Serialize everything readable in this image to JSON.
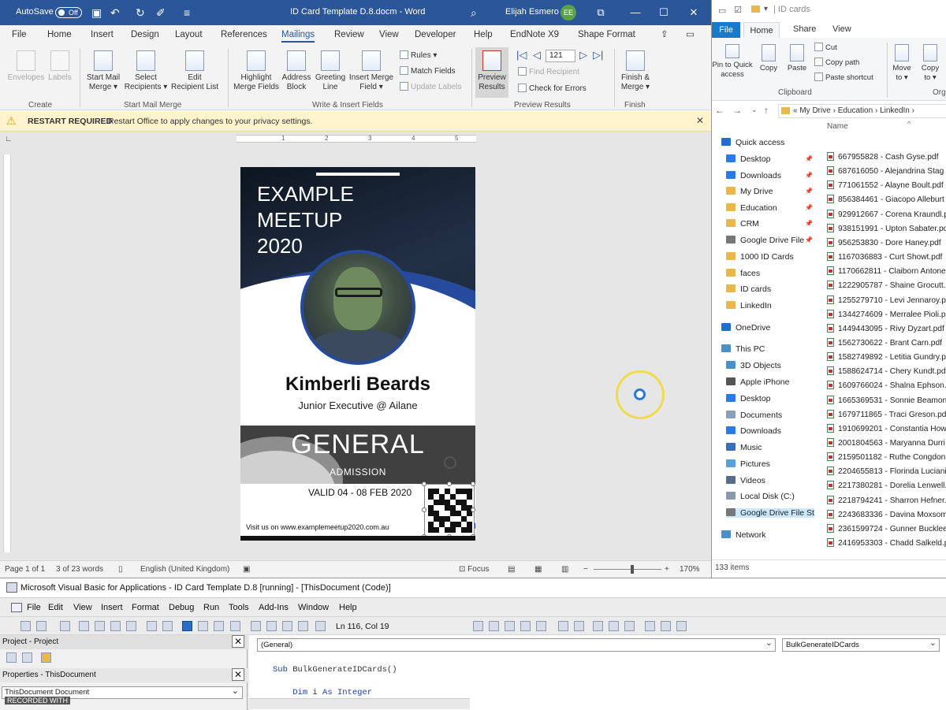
{
  "word": {
    "autosave_label": "AutoSave",
    "autosave_state": "Off",
    "doc_title": "ID Card Template D.8.docm",
    "app_name": "Word",
    "user_name": "Elijah Esmero",
    "user_initials": "EE",
    "menu": [
      "File",
      "Home",
      "Insert",
      "Design",
      "Layout",
      "References",
      "Mailings",
      "Review",
      "View",
      "Developer",
      "Help",
      "EndNote X9",
      "Shape Format"
    ],
    "active_menu": "Mailings",
    "ribbon": {
      "envelopes": "Envelopes",
      "labels": "Labels",
      "start_mail_merge": "Start Mail\nMerge ▾",
      "select_recipients": "Select\nRecipients ▾",
      "edit_recipient_list": "Edit\nRecipient List",
      "highlight_merge_fields": "Highlight\nMerge Fields",
      "address_block": "Address\nBlock",
      "greeting_line": "Greeting\nLine",
      "insert_merge_field": "Insert Merge\nField ▾",
      "rules": "Rules ▾",
      "match_fields": "Match Fields",
      "update_labels": "Update Labels",
      "preview_results": "Preview\nResults",
      "record_number": "121",
      "find_recipient": "Find Recipient",
      "check_for_errors": "Check for Errors",
      "finish_merge": "Finish &\nMerge ▾",
      "groups": [
        "Create",
        "Start Mail Merge",
        "Write & Insert Fields",
        "Preview Results",
        "Finish"
      ]
    },
    "alert": {
      "title": "RESTART REQUIRED",
      "message": "Restart Office to apply changes to your privacy settings."
    },
    "status": {
      "page": "Page 1 of 1",
      "words": "3 of 23 words",
      "language": "English (United Kingdom)",
      "focus": "Focus",
      "zoom": "170%"
    },
    "ruler_marks": [
      "1",
      "2",
      "3",
      "4",
      "5"
    ]
  },
  "card": {
    "event": "EXAMPLE\nMEETUP\n2020",
    "name": "Kimberli Beards",
    "role": "Junior Executive @ Ailane",
    "pass_type": "GENERAL",
    "pass_sub": "ADMISSION",
    "valid": "VALID 04 - 08 FEB 2020",
    "url": "Visit us on www.examplemeetup2020.com.au"
  },
  "explorer": {
    "title": "ID cards",
    "tabs": [
      "File",
      "Home",
      "Share",
      "View"
    ],
    "ribbon": {
      "pin": "Pin to Quick\naccess",
      "copy": "Copy",
      "paste": "Paste",
      "cut": "Cut",
      "copy_path": "Copy path",
      "paste_shortcut": "Paste shortcut",
      "move_to": "Move\nto ▾",
      "copy_to": "Copy\nto ▾",
      "clipboard_group": "Clipboard",
      "organize_group": "Orga"
    },
    "breadcrumb": [
      "My Drive",
      "Education",
      "LinkedIn"
    ],
    "column_name": "Name",
    "nav": [
      {
        "label": "Quick access",
        "icon": "#1e6fd0",
        "pin": false
      },
      {
        "label": "Desktop",
        "icon": "#2c7be5",
        "pin": true
      },
      {
        "label": "Downloads",
        "icon": "#2c7be5",
        "pin": true
      },
      {
        "label": "My Drive",
        "icon": "#e8b94a",
        "pin": true
      },
      {
        "label": "Education",
        "icon": "#e8b94a",
        "pin": true
      },
      {
        "label": "CRM",
        "icon": "#e8b94a",
        "pin": true
      },
      {
        "label": "Google Drive File",
        "icon": "#777777",
        "pin": true
      },
      {
        "label": "1000 ID Cards",
        "icon": "#e8b94a",
        "pin": false
      },
      {
        "label": "faces",
        "icon": "#e8b94a",
        "pin": false
      },
      {
        "label": "ID cards",
        "icon": "#e8b94a",
        "pin": false
      },
      {
        "label": "LinkedIn",
        "icon": "#e8b94a",
        "pin": false
      },
      {
        "label": "OneDrive",
        "icon": "#1e6fd0",
        "pin": false
      },
      {
        "label": "This PC",
        "icon": "#4a90c8",
        "pin": false
      },
      {
        "label": "3D Objects",
        "icon": "#4a90c8",
        "pin": false
      },
      {
        "label": "Apple iPhone",
        "icon": "#555555",
        "pin": false
      },
      {
        "label": "Desktop",
        "icon": "#2c7be5",
        "pin": false
      },
      {
        "label": "Documents",
        "icon": "#8aa0b8",
        "pin": false
      },
      {
        "label": "Downloads",
        "icon": "#2c7be5",
        "pin": false
      },
      {
        "label": "Music",
        "icon": "#3a6fb8",
        "pin": false
      },
      {
        "label": "Pictures",
        "icon": "#5aa0d8",
        "pin": false
      },
      {
        "label": "Videos",
        "icon": "#5a6b88",
        "pin": false
      },
      {
        "label": "Local Disk (C:)",
        "icon": "#8a9aaa",
        "pin": false
      },
      {
        "label": "Google Drive File St",
        "icon": "#777777",
        "pin": false
      },
      {
        "label": "Network",
        "icon": "#4a90c8",
        "pin": false
      }
    ],
    "files": [
      "667955828 - Cash Gyse.pdf",
      "687616050 - Alejandrina Stag",
      "771061552 - Alayne Boult.pdf",
      "856384461 - Giacopo Alleburt",
      "929912667 - Corena Kraundl.p",
      "938151991 - Upton Sabater.pd",
      "956253830 - Dore Haney.pdf",
      "1167036883 - Curt Showt.pdf",
      "1170662811 - Claiborn Antone",
      "1222905787 - Shaine Grocutt.p",
      "1255279710 - Levi Jennaroy.pd",
      "1344274609 - Merralee Pioli.p",
      "1449443095 - Rivy Dyzart.pdf",
      "1562730622 - Brant Carn.pdf",
      "1582749892 - Letitia Gundry.p",
      "1588624714 - Chery Kundt.pdf",
      "1609766024 - Shalna Ephson.p",
      "1665369531 - Sonnie Beamont",
      "1679711865 - Traci Greson.pdf",
      "1910699201 - Constantia How",
      "2001804563 - Maryanna Durri",
      "2159501182 - Ruthe Congdon",
      "2204655813 - Florinda Luciani",
      "2217380281 - Dorelia Lenwell.p",
      "2218794241 - Sharron Hefner.p",
      "2243683336 - Davina Moxsom",
      "2361599724 - Gunner Bucklee.",
      "2416953303 - Chadd Salkeld.p"
    ],
    "item_count": "133 items"
  },
  "vba": {
    "title": "Microsoft Visual Basic for Applications - ID Card Template D.8 [running] - [ThisDocument (Code)]",
    "menu": [
      "File",
      "Edit",
      "View",
      "Insert",
      "Format",
      "Debug",
      "Run",
      "Tools",
      "Add-Ins",
      "Window",
      "Help"
    ],
    "position": "Ln 116, Col 19",
    "project_title": "Project - Project",
    "properties_title": "Properties - ThisDocument",
    "properties_object": "ThisDocument",
    "properties_type": "Document",
    "object_combo": "(General)",
    "proc_combo": "BulkGenerateIDCards",
    "code_line1_kw": "Sub",
    "code_line1": " BulkGenerateIDCards()",
    "code_line2_kw": "Dim",
    "code_line2_rest": " i ",
    "code_line2_kw2": "As",
    "code_line2_type": " Integer",
    "watermark": "RECORDED WITH"
  }
}
